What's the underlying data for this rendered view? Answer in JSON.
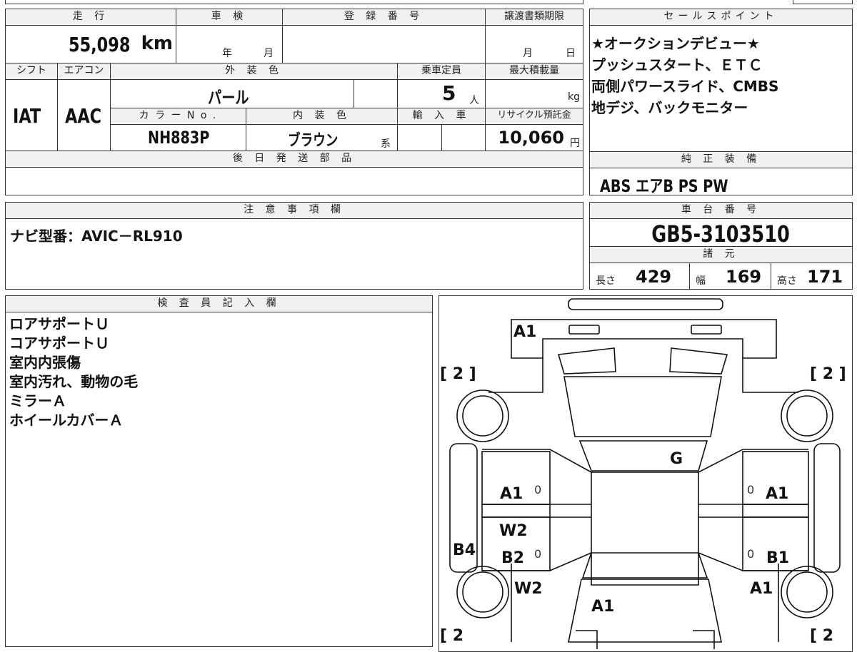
{
  "labels": {
    "mileage": "走 行",
    "inspection": "車 検",
    "registration": "登 録 番 号",
    "transfer_deadline": "譲渡書類期限",
    "sales_points": "セールスポイント",
    "shift": "シフト",
    "aircon": "エアコン",
    "exterior_color": "外 装 色",
    "capacity": "乗車定員",
    "max_load": "最大積載量",
    "color_no": "カ ラ ー N o .",
    "interior_color": "内 装 色",
    "import": "輸 入 車",
    "recycle_fee": "リサイクル預託金",
    "later_parts": "後 日 発 送 部 品",
    "standard_equipment": "純 正 装 備",
    "notes": "注 意 事 項 欄",
    "chassis_no": "車 台 番 号",
    "specs": "諸 元",
    "inspector_notes": "検 査 員 記 入 欄"
  },
  "vehicle": {
    "mileage_value": "55,098",
    "mileage_unit": "km",
    "inspection_year_unit": "年",
    "inspection_month_unit": "月",
    "deadline_month_unit": "月",
    "deadline_day_unit": "日",
    "shift": "IAT",
    "aircon": "AAC",
    "exterior_color": "パール",
    "capacity": "5",
    "capacity_unit": "人",
    "max_load_unit": "kg",
    "color_no": "NH883P",
    "interior_color": "ブラウン",
    "interior_suffix": "系",
    "recycle_fee": "10,060",
    "recycle_unit": "円"
  },
  "sales_points": [
    "★オークションデビュー★",
    "プッシュスタート、ＥＴＣ",
    "両側パワースライド、CMBS",
    "地デジ、バックモニター"
  ],
  "standard_equipment": "ABS エアB PS PW",
  "notes_text": "ナビ型番：AVIC－RL910",
  "chassis_no": "GB5-3103510",
  "specs": {
    "length_label": "長さ",
    "length": "429",
    "width_label": "幅",
    "width": "169",
    "height_label": "高さ",
    "height": "171"
  },
  "inspector_lines": [
    "ロアサポートＵ",
    "コアサポートＵ",
    "室内内張傷",
    "室内汚れ、動物の毛",
    "ミラーＡ",
    "ホイールカバーＡ"
  ],
  "diagram": {
    "tire_tl": "[ 2 ]",
    "tire_tr": "[ 2 ]",
    "tire_bl": "[ 2",
    "tire_br": "[ 2",
    "front_bumper": "A1",
    "roof": "G",
    "left_front_door": "A1",
    "right_front_door": "A1",
    "left_rear_w": "W2",
    "left_rear_b": "B2",
    "right_rear_b": "B1",
    "left_quarter": "B4",
    "left_rear_fender": "W2",
    "right_rear_fender": "A1",
    "rear_hatch": "A1",
    "zero_left_front": "0",
    "zero_right_front": "0",
    "zero_left_rear": "0",
    "zero_right_rear": "0"
  }
}
